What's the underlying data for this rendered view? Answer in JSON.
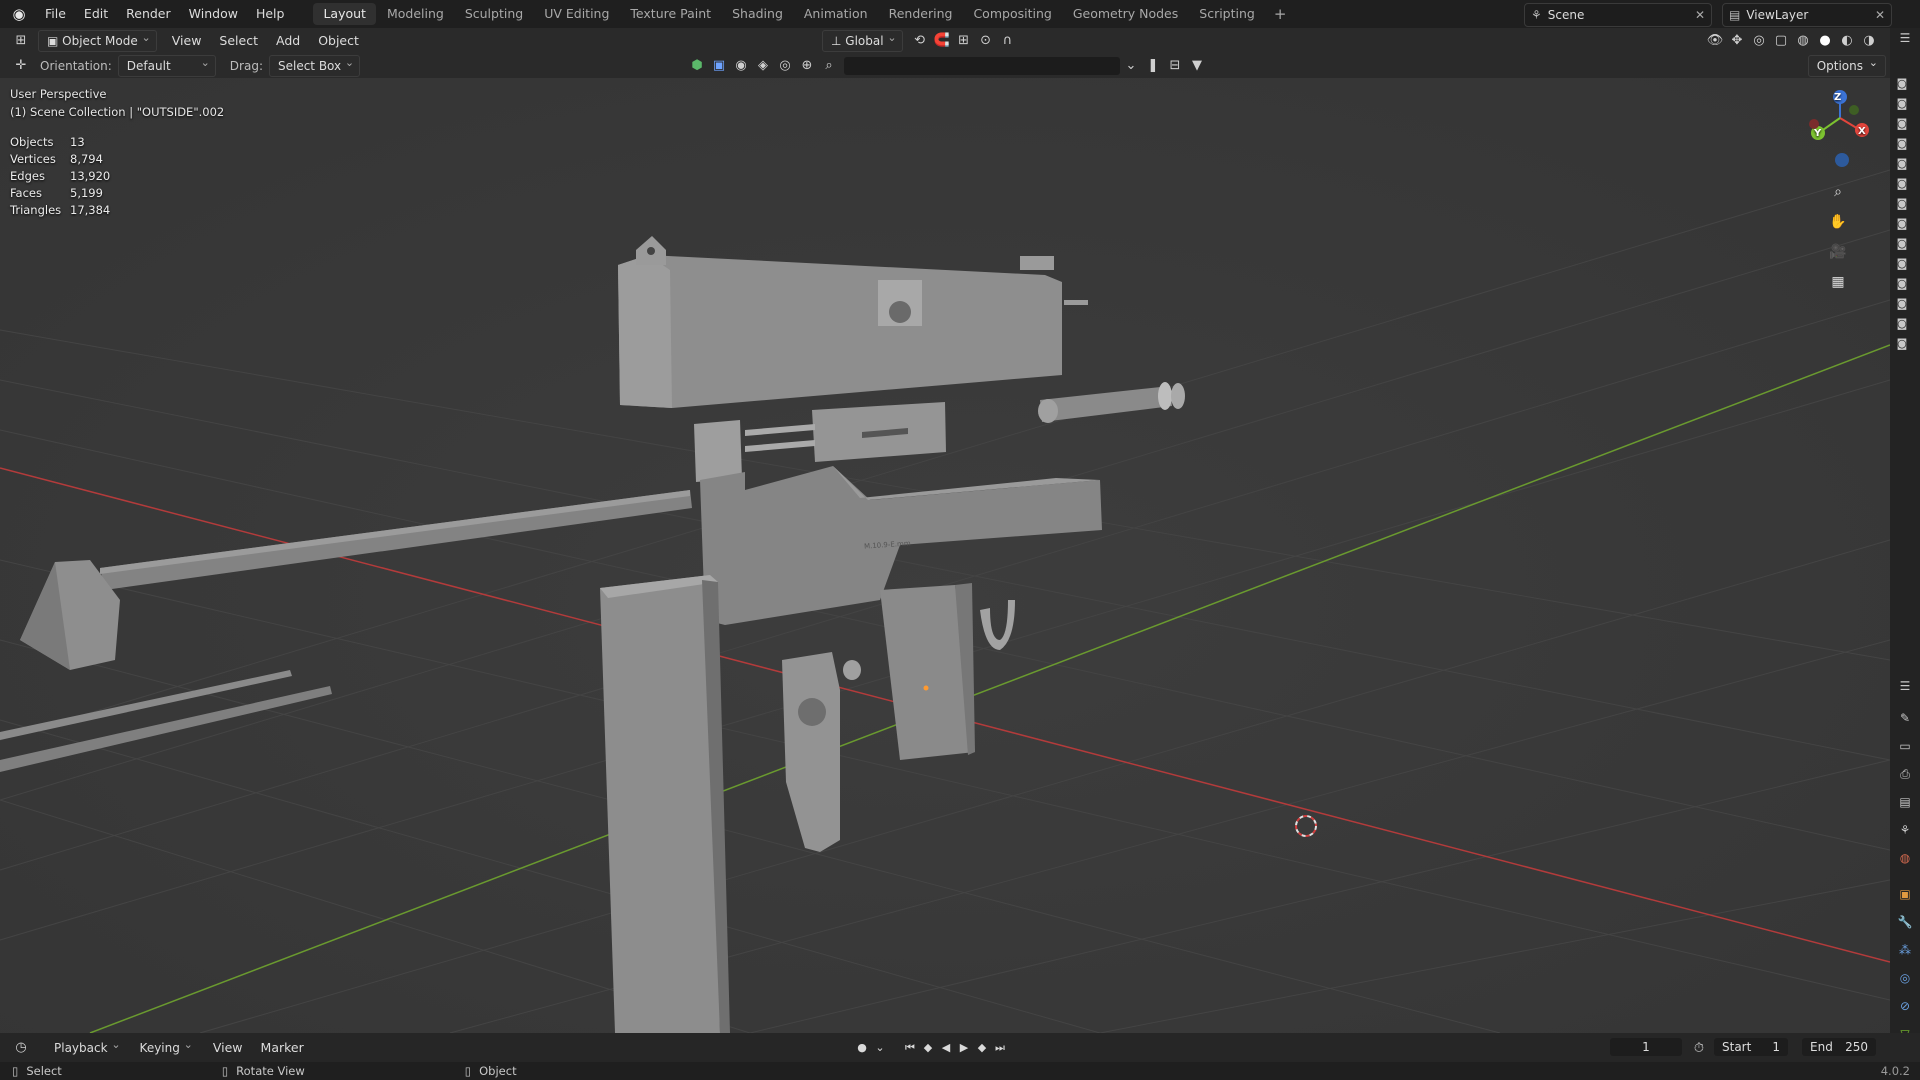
{
  "menu": {
    "items": [
      "File",
      "Edit",
      "Render",
      "Window",
      "Help"
    ]
  },
  "workspaces": {
    "tabs": [
      "Layout",
      "Modeling",
      "Sculpting",
      "UV Editing",
      "Texture Paint",
      "Shading",
      "Animation",
      "Rendering",
      "Compositing",
      "Geometry Nodes",
      "Scripting"
    ],
    "active": "Layout"
  },
  "scene": {
    "name": "Scene",
    "view_layer": "ViewLayer"
  },
  "header": {
    "mode": "Object Mode",
    "menus": [
      "View",
      "Select",
      "Add",
      "Object"
    ],
    "transform_orientation": "Global"
  },
  "tool_settings": {
    "orientation_label": "Orientation:",
    "orientation_value": "Default",
    "drag_label": "Drag:",
    "drag_value": "Select Box",
    "options_label": "Options"
  },
  "viewport": {
    "perspective": "User Perspective",
    "collection": "(1) Scene Collection | \"OUTSIDE\".002",
    "stats": [
      {
        "label": "Objects",
        "value": "13"
      },
      {
        "label": "Vertices",
        "value": "8,794"
      },
      {
        "label": "Edges",
        "value": "13,920"
      },
      {
        "label": "Faces",
        "value": "5,199"
      },
      {
        "label": "Triangles",
        "value": "17,384"
      }
    ],
    "gizmo": {
      "x": "X",
      "y": "Y",
      "z": "Z"
    },
    "receiver_engraving": "M.10.9-E.mm"
  },
  "timeline": {
    "menus": [
      "Playback",
      "Keying",
      "View",
      "Marker"
    ],
    "current_frame": "1",
    "start_label": "Start",
    "start": "1",
    "end_label": "End",
    "end": "250"
  },
  "statusbar": {
    "select": "Select",
    "rotate": "Rotate View",
    "object": "Object",
    "version": "4.0.2"
  },
  "colors": {
    "x_axis": "#b33b3b",
    "y_axis": "#6a9a2f",
    "gizmo_z": "#2f6fd1",
    "gizmo_x": "#e2453c",
    "gizmo_y": "#7cc230"
  }
}
